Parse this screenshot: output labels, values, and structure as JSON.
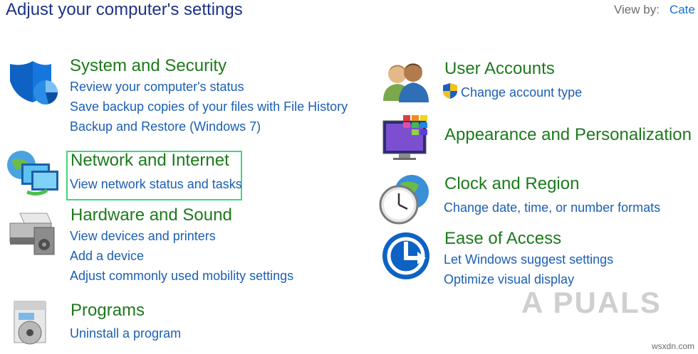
{
  "header": {
    "title": "Adjust your computer's settings",
    "view_by_label": "View by:",
    "view_by_value": "Cate"
  },
  "categories": [
    {
      "title": "System and Security",
      "icon": "shield-icon",
      "links": [
        "Review your computer's status",
        "Save backup copies of your files with File History",
        "Backup and Restore (Windows 7)"
      ]
    },
    {
      "title": "Network and Internet",
      "icon": "network-globe-icon",
      "links": [
        "View network status and tasks"
      ]
    },
    {
      "title": "Hardware and Sound",
      "icon": "printer-icon",
      "links": [
        "View devices and printers",
        "Add a device",
        "Adjust commonly used mobility settings"
      ]
    },
    {
      "title": "Programs",
      "icon": "programs-disc-icon",
      "links": [
        "Uninstall a program"
      ]
    },
    {
      "title": "User Accounts",
      "icon": "users-icon",
      "links": [
        "Change account type"
      ]
    },
    {
      "title": "Appearance and Personalization",
      "icon": "monitor-palette-icon",
      "links": []
    },
    {
      "title": "Clock and Region",
      "icon": "clock-globe-icon",
      "links": [
        "Change date, time, or number formats"
      ]
    },
    {
      "title": "Ease of Access",
      "icon": "ease-of-access-icon",
      "links": [
        "Let Windows suggest settings",
        "Optimize visual display"
      ]
    }
  ],
  "watermark": "A PUALS",
  "source_label": "wsxdn.com",
  "colors": {
    "title": "#1e3287",
    "category": "#1d7a1d",
    "link": "#1b5fb4",
    "highlight": "#3fd77a"
  }
}
